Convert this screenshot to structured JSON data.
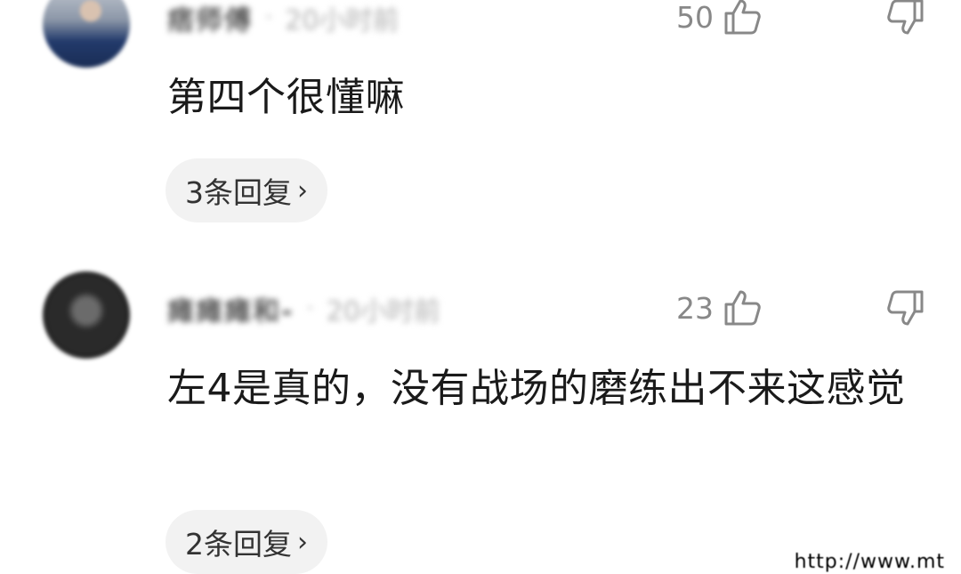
{
  "comments": [
    {
      "username": "痞师傅",
      "time": "20小时前",
      "likes": "50",
      "text": "第四个很懂嘛",
      "replies_label": "3条回复"
    },
    {
      "username": "瘫瘫瘫和-",
      "time": "20小时前",
      "likes": "23",
      "text": "左4是真的，没有战场的磨练出不来这感觉",
      "replies_label": "2条回复"
    }
  ],
  "icons": {
    "like": "thumbs-up-icon",
    "dislike": "thumbs-down-icon",
    "chevron": "chevron-right-icon"
  },
  "chevron_glyph": "›",
  "watermark": "http://www.mt"
}
